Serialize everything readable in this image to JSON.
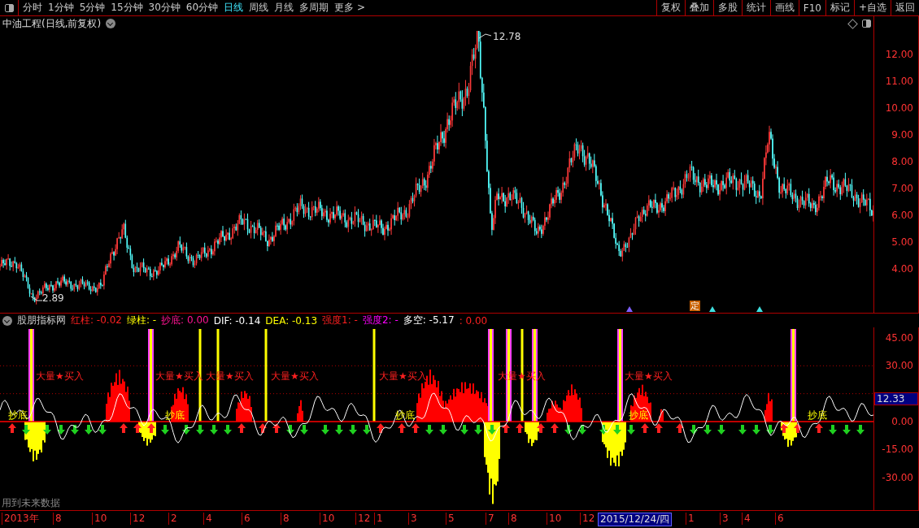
{
  "toolbar": {
    "periods": [
      {
        "label": "分时",
        "selected": false
      },
      {
        "label": "1分钟",
        "selected": false
      },
      {
        "label": "5分钟",
        "selected": false
      },
      {
        "label": "15分钟",
        "selected": false
      },
      {
        "label": "30分钟",
        "selected": false
      },
      {
        "label": "60分钟",
        "selected": false
      },
      {
        "label": "日线",
        "selected": true
      },
      {
        "label": "周线",
        "selected": false
      },
      {
        "label": "月线",
        "selected": false
      },
      {
        "label": "多周期",
        "selected": false
      },
      {
        "label": "更多 >",
        "selected": false
      }
    ],
    "actions": [
      "复权",
      "叠加",
      "多股",
      "统计",
      "画线",
      "F10",
      "标记",
      "+自选",
      "返回"
    ]
  },
  "chart": {
    "title": "中油工程(日线,前复权)",
    "high_label": "12.78",
    "low_label": "2.89",
    "badge": "定",
    "price_ticks": [
      "12.00",
      "11.00",
      "10.00",
      "9.00",
      "8.00",
      "7.00",
      "6.00",
      "5.00",
      "4.00"
    ]
  },
  "indicator": {
    "name": "股朋指标网",
    "legend": [
      {
        "label": "红柱:",
        "value": "-0.02",
        "color": "#ff2020"
      },
      {
        "label": "绿柱:",
        "value": "-",
        "color": "#ffff00"
      },
      {
        "label": "抄底:",
        "value": "0.00",
        "color": "#ff1493"
      },
      {
        "label": "DIF:",
        "value": "-0.14",
        "color": "#ffffff"
      },
      {
        "label": "DEA:",
        "value": "-0.13",
        "color": "#ffff00"
      },
      {
        "label": "强度1:",
        "value": "-",
        "color": "#ff2020"
      },
      {
        "label": "强度2:",
        "value": "-",
        "color": "#ff00ff"
      },
      {
        "label": "多空:",
        "value": "-5.17",
        "color": "#ffffff"
      },
      {
        "label": ":",
        "value": "0.00",
        "color": "#ff2020"
      }
    ],
    "ticks": [
      "45.00",
      "30.00",
      "0.00",
      "-15.00",
      "-30.00"
    ],
    "current_value": "12.33",
    "signals": [
      "大量★买入",
      "大量★买入",
      "大量★买入",
      "大量★买入",
      "大量★买入",
      "大量★买入",
      "大量★买入"
    ],
    "bottom_labels": [
      "抄底",
      "抄底",
      "抄底",
      "抄底",
      "抄底"
    ]
  },
  "note": "用到未来数据",
  "date_axis": [
    {
      "label": "2013年",
      "selected": false
    },
    {
      "label": "8",
      "selected": false
    },
    {
      "label": "10",
      "selected": false
    },
    {
      "label": "12",
      "selected": false
    },
    {
      "label": "2",
      "selected": false
    },
    {
      "label": "4",
      "selected": false
    },
    {
      "label": "6",
      "selected": false
    },
    {
      "label": "8",
      "selected": false
    },
    {
      "label": "10",
      "selected": false
    },
    {
      "label": "12",
      "selected": false
    },
    {
      "label": "1",
      "selected": false
    },
    {
      "label": "3",
      "selected": false
    },
    {
      "label": "5",
      "selected": false
    },
    {
      "label": "7",
      "selected": false
    },
    {
      "label": "8",
      "selected": false
    },
    {
      "label": "10",
      "selected": false
    },
    {
      "label": "12",
      "selected": false
    },
    {
      "label": "2015/12/24/四",
      "selected": true
    },
    {
      "label": "1",
      "selected": false
    },
    {
      "label": "3",
      "selected": false
    },
    {
      "label": "4",
      "selected": false
    },
    {
      "label": "6",
      "selected": false
    }
  ]
}
